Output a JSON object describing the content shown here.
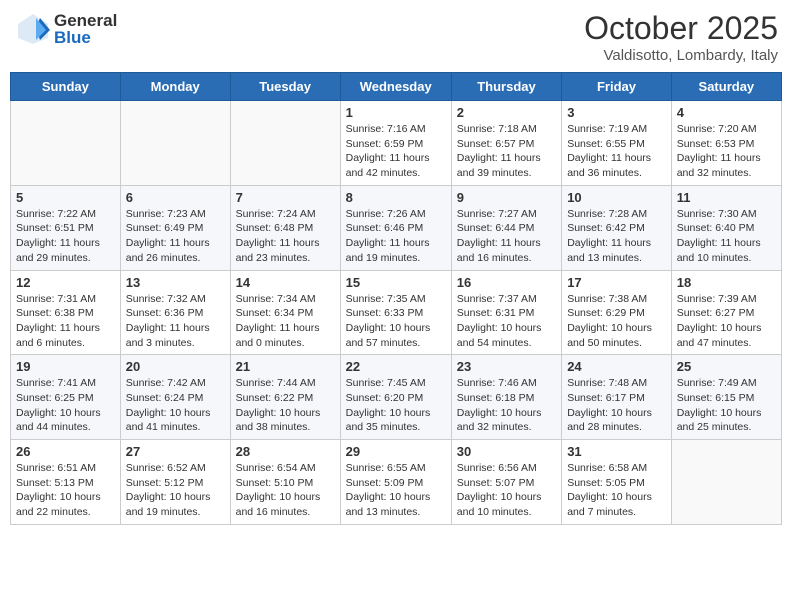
{
  "header": {
    "logo_general": "General",
    "logo_blue": "Blue",
    "month": "October 2025",
    "location": "Valdisotto, Lombardy, Italy"
  },
  "days_of_week": [
    "Sunday",
    "Monday",
    "Tuesday",
    "Wednesday",
    "Thursday",
    "Friday",
    "Saturday"
  ],
  "weeks": [
    [
      {
        "day": "",
        "info": ""
      },
      {
        "day": "",
        "info": ""
      },
      {
        "day": "",
        "info": ""
      },
      {
        "day": "1",
        "info": "Sunrise: 7:16 AM\nSunset: 6:59 PM\nDaylight: 11 hours and 42 minutes."
      },
      {
        "day": "2",
        "info": "Sunrise: 7:18 AM\nSunset: 6:57 PM\nDaylight: 11 hours and 39 minutes."
      },
      {
        "day": "3",
        "info": "Sunrise: 7:19 AM\nSunset: 6:55 PM\nDaylight: 11 hours and 36 minutes."
      },
      {
        "day": "4",
        "info": "Sunrise: 7:20 AM\nSunset: 6:53 PM\nDaylight: 11 hours and 32 minutes."
      }
    ],
    [
      {
        "day": "5",
        "info": "Sunrise: 7:22 AM\nSunset: 6:51 PM\nDaylight: 11 hours and 29 minutes."
      },
      {
        "day": "6",
        "info": "Sunrise: 7:23 AM\nSunset: 6:49 PM\nDaylight: 11 hours and 26 minutes."
      },
      {
        "day": "7",
        "info": "Sunrise: 7:24 AM\nSunset: 6:48 PM\nDaylight: 11 hours and 23 minutes."
      },
      {
        "day": "8",
        "info": "Sunrise: 7:26 AM\nSunset: 6:46 PM\nDaylight: 11 hours and 19 minutes."
      },
      {
        "day": "9",
        "info": "Sunrise: 7:27 AM\nSunset: 6:44 PM\nDaylight: 11 hours and 16 minutes."
      },
      {
        "day": "10",
        "info": "Sunrise: 7:28 AM\nSunset: 6:42 PM\nDaylight: 11 hours and 13 minutes."
      },
      {
        "day": "11",
        "info": "Sunrise: 7:30 AM\nSunset: 6:40 PM\nDaylight: 11 hours and 10 minutes."
      }
    ],
    [
      {
        "day": "12",
        "info": "Sunrise: 7:31 AM\nSunset: 6:38 PM\nDaylight: 11 hours and 6 minutes."
      },
      {
        "day": "13",
        "info": "Sunrise: 7:32 AM\nSunset: 6:36 PM\nDaylight: 11 hours and 3 minutes."
      },
      {
        "day": "14",
        "info": "Sunrise: 7:34 AM\nSunset: 6:34 PM\nDaylight: 11 hours and 0 minutes."
      },
      {
        "day": "15",
        "info": "Sunrise: 7:35 AM\nSunset: 6:33 PM\nDaylight: 10 hours and 57 minutes."
      },
      {
        "day": "16",
        "info": "Sunrise: 7:37 AM\nSunset: 6:31 PM\nDaylight: 10 hours and 54 minutes."
      },
      {
        "day": "17",
        "info": "Sunrise: 7:38 AM\nSunset: 6:29 PM\nDaylight: 10 hours and 50 minutes."
      },
      {
        "day": "18",
        "info": "Sunrise: 7:39 AM\nSunset: 6:27 PM\nDaylight: 10 hours and 47 minutes."
      }
    ],
    [
      {
        "day": "19",
        "info": "Sunrise: 7:41 AM\nSunset: 6:25 PM\nDaylight: 10 hours and 44 minutes."
      },
      {
        "day": "20",
        "info": "Sunrise: 7:42 AM\nSunset: 6:24 PM\nDaylight: 10 hours and 41 minutes."
      },
      {
        "day": "21",
        "info": "Sunrise: 7:44 AM\nSunset: 6:22 PM\nDaylight: 10 hours and 38 minutes."
      },
      {
        "day": "22",
        "info": "Sunrise: 7:45 AM\nSunset: 6:20 PM\nDaylight: 10 hours and 35 minutes."
      },
      {
        "day": "23",
        "info": "Sunrise: 7:46 AM\nSunset: 6:18 PM\nDaylight: 10 hours and 32 minutes."
      },
      {
        "day": "24",
        "info": "Sunrise: 7:48 AM\nSunset: 6:17 PM\nDaylight: 10 hours and 28 minutes."
      },
      {
        "day": "25",
        "info": "Sunrise: 7:49 AM\nSunset: 6:15 PM\nDaylight: 10 hours and 25 minutes."
      }
    ],
    [
      {
        "day": "26",
        "info": "Sunrise: 6:51 AM\nSunset: 5:13 PM\nDaylight: 10 hours and 22 minutes."
      },
      {
        "day": "27",
        "info": "Sunrise: 6:52 AM\nSunset: 5:12 PM\nDaylight: 10 hours and 19 minutes."
      },
      {
        "day": "28",
        "info": "Sunrise: 6:54 AM\nSunset: 5:10 PM\nDaylight: 10 hours and 16 minutes."
      },
      {
        "day": "29",
        "info": "Sunrise: 6:55 AM\nSunset: 5:09 PM\nDaylight: 10 hours and 13 minutes."
      },
      {
        "day": "30",
        "info": "Sunrise: 6:56 AM\nSunset: 5:07 PM\nDaylight: 10 hours and 10 minutes."
      },
      {
        "day": "31",
        "info": "Sunrise: 6:58 AM\nSunset: 5:05 PM\nDaylight: 10 hours and 7 minutes."
      },
      {
        "day": "",
        "info": ""
      }
    ]
  ]
}
